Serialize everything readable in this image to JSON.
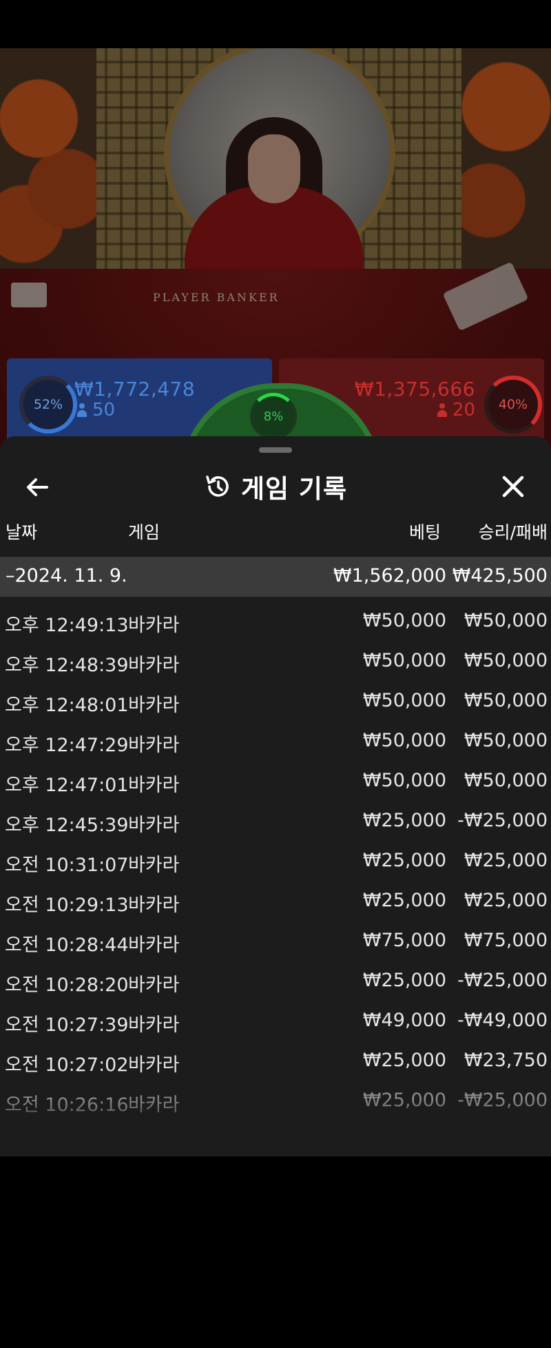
{
  "video": {
    "table_text": "PLAYER   BANKER"
  },
  "bets": {
    "player": {
      "percent": "52%",
      "amount": "₩1,772,478",
      "count": "50",
      "color": "#3a78d8"
    },
    "banker": {
      "percent": "40%",
      "amount": "₩1,375,666",
      "count": "20",
      "color": "#d42c2c"
    },
    "tie": {
      "percent": "8%",
      "color": "#2ad84a"
    }
  },
  "sheet": {
    "title": "게임 기록",
    "back_icon": "arrow-left-icon",
    "history_icon": "history-icon",
    "close_icon": "close-icon",
    "columns": {
      "date": "날짜",
      "game": "게임",
      "bet": "베팅",
      "win_loss": "승리/패배"
    },
    "summary": {
      "date": "–2024. 11. 9.",
      "bet": "₩1,562,000",
      "win_loss": "₩425,500"
    },
    "rows": [
      {
        "time": "오후 12:49:13",
        "game": "바카라",
        "bet": "₩50,000",
        "win_loss": "₩50,000"
      },
      {
        "time": "오후 12:48:39",
        "game": "바카라",
        "bet": "₩50,000",
        "win_loss": "₩50,000"
      },
      {
        "time": "오후 12:48:01",
        "game": "바카라",
        "bet": "₩50,000",
        "win_loss": "₩50,000"
      },
      {
        "time": "오후 12:47:29",
        "game": "바카라",
        "bet": "₩50,000",
        "win_loss": "₩50,000"
      },
      {
        "time": "오후 12:47:01",
        "game": "바카라",
        "bet": "₩50,000",
        "win_loss": "₩50,000"
      },
      {
        "time": "오후 12:45:39",
        "game": "바카라",
        "bet": "₩25,000",
        "win_loss": "-₩25,000"
      },
      {
        "time": "오전 10:31:07",
        "game": "바카라",
        "bet": "₩25,000",
        "win_loss": "₩25,000"
      },
      {
        "time": "오전 10:29:13",
        "game": "바카라",
        "bet": "₩25,000",
        "win_loss": "₩25,000"
      },
      {
        "time": "오전 10:28:44",
        "game": "바카라",
        "bet": "₩75,000",
        "win_loss": "₩75,000"
      },
      {
        "time": "오전 10:28:20",
        "game": "바카라",
        "bet": "₩25,000",
        "win_loss": "-₩25,000"
      },
      {
        "time": "오전 10:27:39",
        "game": "바카라",
        "bet": "₩49,000",
        "win_loss": "-₩49,000"
      },
      {
        "time": "오전 10:27:02",
        "game": "바카라",
        "bet": "₩25,000",
        "win_loss": "₩23,750"
      },
      {
        "time": "오전 10:26:16",
        "game": "바카라",
        "bet": "₩25,000",
        "win_loss": "-₩25,000"
      }
    ]
  }
}
